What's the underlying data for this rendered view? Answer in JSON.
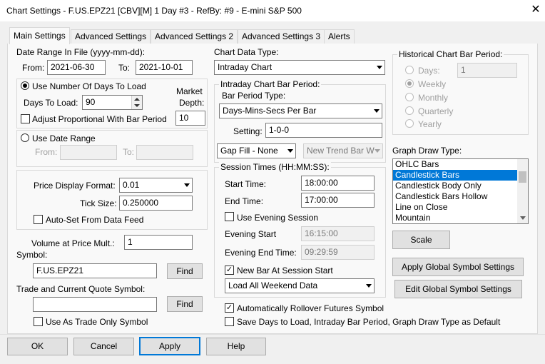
{
  "window": {
    "title": "Chart Settings - F.US.EPZ21 [CBV][M]  1 Day   #3 - RefBy: #9 - E-mini S&P 500",
    "close_glyph": "✕"
  },
  "tabs": [
    "Main Settings",
    "Advanced Settings",
    "Advanced Settings 2",
    "Advanced Settings 3",
    "Alerts"
  ],
  "date_range": {
    "label": "Date Range In File (yyyy-mm-dd):",
    "from_label": "From:",
    "from_value": "2021-06-30",
    "to_label": "To:",
    "to_value": "2021-10-01"
  },
  "days_group": {
    "use_days_label": "Use Number Of Days To Load",
    "days_to_load_label": "Days To Load:",
    "days_to_load_value": "90",
    "market_depth_label_1": "Market",
    "market_depth_label_2": "Depth:",
    "market_depth_value": "10",
    "adjust_label": "Adjust Proportional With Bar Period"
  },
  "date_range_group": {
    "use_date_range_label": "Use Date Range",
    "from_label": "From:",
    "to_label": "To:"
  },
  "price_group": {
    "price_display_format_label": "Price Display Format:",
    "price_display_format_value": "0.01",
    "tick_size_label": "Tick Size:",
    "tick_size_value": "0.250000",
    "auto_set_label": "Auto-Set From Data Feed"
  },
  "volume": {
    "label": "Volume at Price Mult.:",
    "value": "1"
  },
  "symbol": {
    "label": "Symbol:",
    "value": "F.US.EPZ21",
    "find_label": "Find"
  },
  "trade_symbol": {
    "label": "Trade and Current Quote Symbol:",
    "value": "",
    "find_label": "Find",
    "trade_only_label": "Use As Trade Only Symbol"
  },
  "chart_data_type": {
    "label": "Chart Data Type:",
    "value": "Intraday Chart"
  },
  "intraday_group": {
    "title": "Intraday Chart Bar Period:",
    "bar_period_type_label": "Bar Period Type:",
    "bar_period_type_value": "Days-Mins-Secs Per Bar",
    "setting_label": "Setting:",
    "setting_value": "1-0-0",
    "gap_fill_value": "Gap Fill - None",
    "new_trend_bar_value": "New Trend Bar W"
  },
  "session_group": {
    "title": "Session Times (HH:MM:SS):",
    "start_time_label": "Start Time:",
    "start_time_value": "18:00:00",
    "end_time_label": "End Time:",
    "end_time_value": "17:00:00",
    "use_evening_label": "Use Evening Session",
    "evening_start_label": "Evening Start",
    "evening_start_value": "16:15:00",
    "evening_end_label": "Evening End Time:",
    "evening_end_value": "09:29:59",
    "new_bar_label": "New Bar At Session Start",
    "weekend_value": "Load All Weekend Data"
  },
  "auto_rollover_label": "Automatically Rollover Futures Symbol",
  "save_defaults_label": "Save Days to Load, Intraday Bar Period, Graph Draw Type as Default",
  "historical_group": {
    "title": "Historical Chart Bar Period:",
    "days_label": "Days:",
    "days_value": "1",
    "options": [
      "Weekly",
      "Monthly",
      "Quarterly",
      "Yearly"
    ]
  },
  "graph_draw": {
    "label": "Graph Draw Type:",
    "items": [
      "OHLC Bars",
      "Candlestick Bars",
      "Candlestick Body Only",
      "Candlestick Bars Hollow",
      "Line on Close",
      "Mountain"
    ],
    "selected_color": "#0078d7"
  },
  "side_buttons": {
    "scale": "Scale",
    "apply_global": "Apply Global Symbol Settings",
    "edit_global": "Edit Global Symbol Settings"
  },
  "footer": {
    "ok": "OK",
    "cancel": "Cancel",
    "apply": "Apply",
    "help": "Help"
  }
}
